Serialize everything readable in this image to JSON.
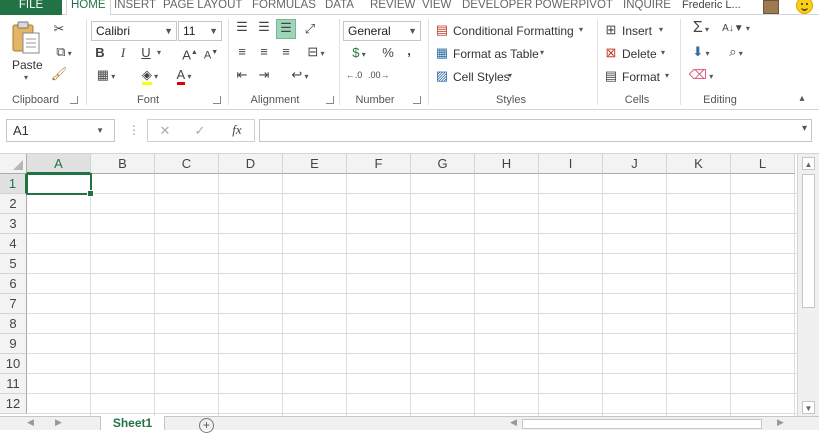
{
  "tabs": {
    "file": "FILE",
    "items": [
      "HOME",
      "INSERT",
      "PAGE LAYOUT",
      "FORMULAS",
      "DATA",
      "REVIEW",
      "VIEW",
      "DEVELOPER",
      "POWERPIVOT",
      "INQUIRE"
    ],
    "user": "Frederic L..."
  },
  "ribbon": {
    "clipboard": {
      "label": "Clipboard",
      "paste": "Paste"
    },
    "font": {
      "label": "Font",
      "name": "Calibri",
      "size": "11",
      "bold": "B",
      "italic": "I",
      "underline": "U"
    },
    "alignment": {
      "label": "Alignment"
    },
    "number": {
      "label": "Number",
      "format": "General",
      "percent": "%",
      "comma": ","
    },
    "styles": {
      "label": "Styles",
      "conditional": "Conditional Formatting",
      "table": "Format as Table",
      "cellstyles": "Cell Styles"
    },
    "cells": {
      "label": "Cells",
      "insert": "Insert",
      "delete": "Delete",
      "format": "Format"
    },
    "editing": {
      "label": "Editing"
    }
  },
  "formula": {
    "namebox": "A1",
    "fx": "fx",
    "value": ""
  },
  "grid": {
    "columns": [
      "A",
      "B",
      "C",
      "D",
      "E",
      "F",
      "G",
      "H",
      "I",
      "J",
      "K",
      "L"
    ],
    "rows": [
      "1",
      "2",
      "3",
      "4",
      "5",
      "6",
      "7",
      "8",
      "9",
      "10",
      "11",
      "12"
    ],
    "selected_cell": "A1"
  },
  "sheets": {
    "tabs": [
      "Sheet1"
    ]
  },
  "colors": {
    "accent": "#217346",
    "grid": "#dadcdd"
  }
}
